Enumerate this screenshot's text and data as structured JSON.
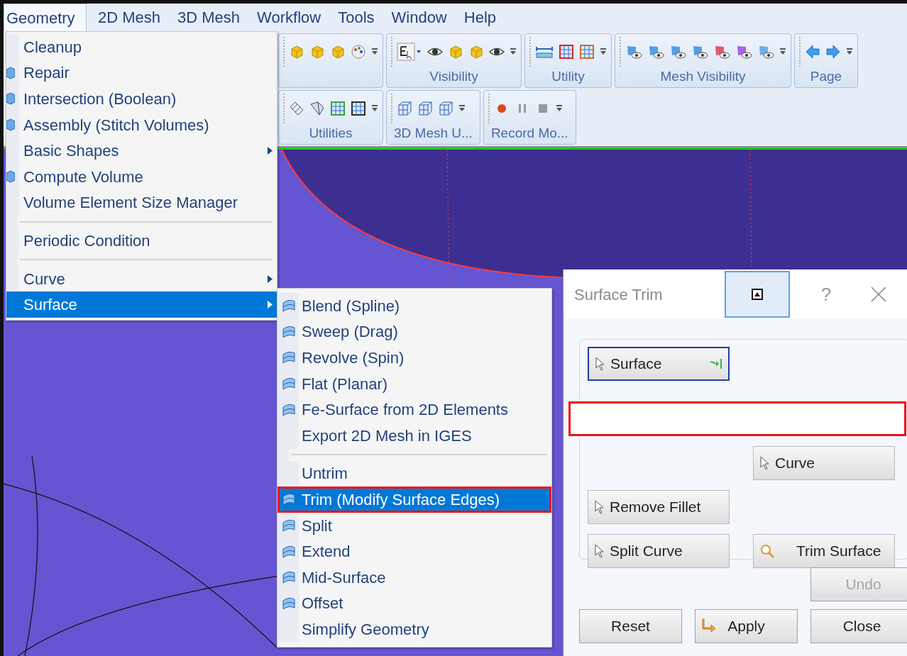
{
  "menubar": [
    {
      "label": "Geometry",
      "selected": true
    },
    {
      "label": "2D Mesh",
      "selected": false
    },
    {
      "label": "3D Mesh",
      "selected": false
    },
    {
      "label": "Workflow",
      "selected": false
    },
    {
      "label": "Tools",
      "selected": false
    },
    {
      "label": "Window",
      "selected": false
    },
    {
      "label": "Help",
      "selected": false
    }
  ],
  "toolbar_rows": [
    {
      "groups": [
        {
          "label": "Visibility"
        },
        {
          "label": "Utility"
        },
        {
          "label": "Mesh Visibility"
        },
        {
          "label": "Page"
        }
      ]
    },
    {
      "groups": [
        {
          "label": "Utilities"
        },
        {
          "label": "3D Mesh U..."
        },
        {
          "label": "Record Mo..."
        }
      ]
    }
  ],
  "geometry_menu": {
    "items": [
      {
        "kind": "item",
        "label": "Cleanup",
        "has_icon": false,
        "submenu": false,
        "selected": false
      },
      {
        "kind": "item",
        "label": "Repair",
        "has_icon": true,
        "submenu": false,
        "selected": false
      },
      {
        "kind": "item",
        "label": "Intersection (Boolean)",
        "has_icon": true,
        "submenu": false,
        "selected": false
      },
      {
        "kind": "item",
        "label": "Assembly (Stitch Volumes)",
        "has_icon": true,
        "submenu": false,
        "selected": false
      },
      {
        "kind": "item",
        "label": "Basic Shapes",
        "has_icon": false,
        "submenu": true,
        "selected": false
      },
      {
        "kind": "item",
        "label": "Compute Volume",
        "has_icon": true,
        "submenu": false,
        "selected": false
      },
      {
        "kind": "item",
        "label": "Volume Element Size Manager",
        "has_icon": false,
        "submenu": false,
        "selected": false
      },
      {
        "kind": "separator"
      },
      {
        "kind": "item",
        "label": "Periodic Condition",
        "has_icon": false,
        "submenu": false,
        "selected": false
      },
      {
        "kind": "separator"
      },
      {
        "kind": "item",
        "label": "Curve",
        "has_icon": false,
        "submenu": true,
        "selected": false
      },
      {
        "kind": "item",
        "label": "Surface",
        "has_icon": false,
        "submenu": true,
        "selected": true
      }
    ]
  },
  "surface_submenu": {
    "items": [
      {
        "kind": "item",
        "label": "Blend (Spline)",
        "has_icon": true,
        "selected": false,
        "annotated": false
      },
      {
        "kind": "item",
        "label": "Sweep (Drag)",
        "has_icon": true,
        "selected": false,
        "annotated": false
      },
      {
        "kind": "item",
        "label": "Revolve (Spin)",
        "has_icon": true,
        "selected": false,
        "annotated": false
      },
      {
        "kind": "item",
        "label": "Flat (Planar)",
        "has_icon": true,
        "selected": false,
        "annotated": false
      },
      {
        "kind": "item",
        "label": "Fe-Surface from 2D Elements",
        "has_icon": true,
        "selected": false,
        "annotated": false
      },
      {
        "kind": "item",
        "label": "Export 2D Mesh in IGES",
        "has_icon": false,
        "selected": false,
        "annotated": false
      },
      {
        "kind": "separator"
      },
      {
        "kind": "item",
        "label": "Untrim",
        "has_icon": false,
        "selected": false,
        "annotated": false
      },
      {
        "kind": "item",
        "label": "Trim (Modify Surface Edges)",
        "has_icon": true,
        "selected": true,
        "annotated": true
      },
      {
        "kind": "item",
        "label": "Split",
        "has_icon": true,
        "selected": false,
        "annotated": false
      },
      {
        "kind": "item",
        "label": "Extend",
        "has_icon": true,
        "selected": false,
        "annotated": false
      },
      {
        "kind": "item",
        "label": "Mid-Surface",
        "has_icon": true,
        "selected": false,
        "annotated": false
      },
      {
        "kind": "item",
        "label": "Offset",
        "has_icon": true,
        "selected": false,
        "annotated": false
      },
      {
        "kind": "item",
        "label": "Simplify Geometry",
        "has_icon": false,
        "selected": false,
        "annotated": false
      }
    ]
  },
  "dialog": {
    "title": "Surface Trim",
    "collapse_active": true,
    "help": "?",
    "controls": [
      {
        "kind": "button",
        "label": "Surface",
        "focused": true
      },
      {
        "kind": "field",
        "annotated": true
      },
      {
        "kind": "button",
        "label": "Curve",
        "focused": false
      },
      {
        "kind": "button",
        "label": "Remove Fillet",
        "focused": false
      },
      {
        "kind": "button",
        "label": "Split Curve",
        "focused": false
      },
      {
        "kind": "button",
        "label": "Trim Surface",
        "focused": false
      }
    ],
    "undo": {
      "label": "Undo",
      "disabled": true
    },
    "footer": [
      {
        "label": "Reset"
      },
      {
        "label": "Apply"
      },
      {
        "label": "Close"
      }
    ]
  }
}
